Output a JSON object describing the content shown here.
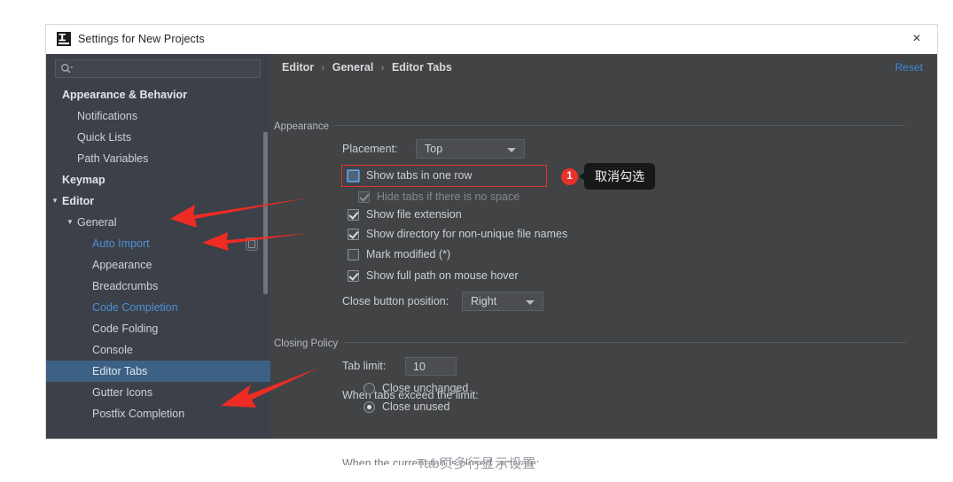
{
  "window": {
    "title": "Settings for New Projects",
    "app_icon": "intellij-idea-icon",
    "close_label": "×"
  },
  "sidebar": {
    "search": {
      "value": "",
      "placeholder": "",
      "icon": "search-icon"
    },
    "items": [
      {
        "label": "Appearance & Behavior",
        "indent": 18,
        "style": "bold",
        "caret": "",
        "selected": false,
        "badge": false
      },
      {
        "label": "Notifications",
        "indent": 35,
        "style": "normal",
        "caret": "",
        "selected": false,
        "badge": false
      },
      {
        "label": "Quick Lists",
        "indent": 35,
        "style": "normal",
        "caret": "",
        "selected": false,
        "badge": false
      },
      {
        "label": "Path Variables",
        "indent": 35,
        "style": "normal",
        "caret": "",
        "selected": false,
        "badge": false
      },
      {
        "label": "Keymap",
        "indent": 18,
        "style": "bold",
        "caret": "",
        "selected": false,
        "badge": false
      },
      {
        "label": "Editor",
        "indent": 18,
        "style": "bold",
        "caret": "▼",
        "caretLeft": 6,
        "selected": false,
        "badge": false
      },
      {
        "label": "General",
        "indent": 35,
        "style": "normal",
        "caret": "▼",
        "caretLeft": 23,
        "selected": false,
        "badge": false
      },
      {
        "label": "Auto Import",
        "indent": 52,
        "style": "link",
        "caret": "",
        "selected": false,
        "badge": true
      },
      {
        "label": "Appearance",
        "indent": 52,
        "style": "normal",
        "caret": "",
        "selected": false,
        "badge": false
      },
      {
        "label": "Breadcrumbs",
        "indent": 52,
        "style": "normal",
        "caret": "",
        "selected": false,
        "badge": false
      },
      {
        "label": "Code Completion",
        "indent": 52,
        "style": "link",
        "caret": "",
        "selected": false,
        "badge": false
      },
      {
        "label": "Code Folding",
        "indent": 52,
        "style": "normal",
        "caret": "",
        "selected": false,
        "badge": false
      },
      {
        "label": "Console",
        "indent": 52,
        "style": "normal",
        "caret": "",
        "selected": false,
        "badge": false
      },
      {
        "label": "Editor Tabs",
        "indent": 52,
        "style": "normal",
        "caret": "",
        "selected": true,
        "badge": false
      },
      {
        "label": "Gutter Icons",
        "indent": 52,
        "style": "normal",
        "caret": "",
        "selected": false,
        "badge": false
      },
      {
        "label": "Postfix Completion",
        "indent": 52,
        "style": "normal",
        "caret": "",
        "selected": false,
        "badge": false
      }
    ]
  },
  "main": {
    "breadcrumb": {
      "part1": "Editor",
      "sep1": "›",
      "part2": "General",
      "sep2": "›",
      "part3": "Editor Tabs"
    },
    "reset_label": "Reset",
    "appearance": {
      "group_title": "Appearance",
      "placement_label": "Placement:",
      "placement_value": "Top",
      "checkboxes": [
        {
          "label": "Show tabs in one row",
          "checked": false,
          "disabled": false,
          "focused": true
        },
        {
          "label": "Hide tabs if there is no space",
          "checked": true,
          "disabled": true,
          "focused": false
        },
        {
          "label": "Show file extension",
          "checked": true,
          "disabled": false,
          "focused": false
        },
        {
          "label": "Show directory for non-unique file names",
          "checked": true,
          "disabled": false,
          "focused": false
        },
        {
          "label": "Mark modified (*)",
          "checked": false,
          "disabled": false,
          "focused": false
        },
        {
          "label": "Show full path on mouse hover",
          "checked": true,
          "disabled": false,
          "focused": false
        }
      ],
      "close_button_label": "Close button position:",
      "close_button_value": "Right"
    },
    "closing_policy": {
      "group_title": "Closing Policy",
      "tab_limit_label": "Tab limit:",
      "tab_limit_value": "10",
      "exceed_label": "When tabs exceed the limit:",
      "radios": [
        {
          "label": "Close unchanged",
          "checked": false
        },
        {
          "label": "Close unused",
          "checked": true
        }
      ],
      "cutoff_label": "When the current tab is closed, activate:"
    }
  },
  "annotations": {
    "badge_1": "1",
    "tooltip_1": "取消勾选",
    "highlight_color": "#e8312b",
    "arrow_color": "#ee2c24"
  },
  "caption": "Tab页多行显示设置"
}
